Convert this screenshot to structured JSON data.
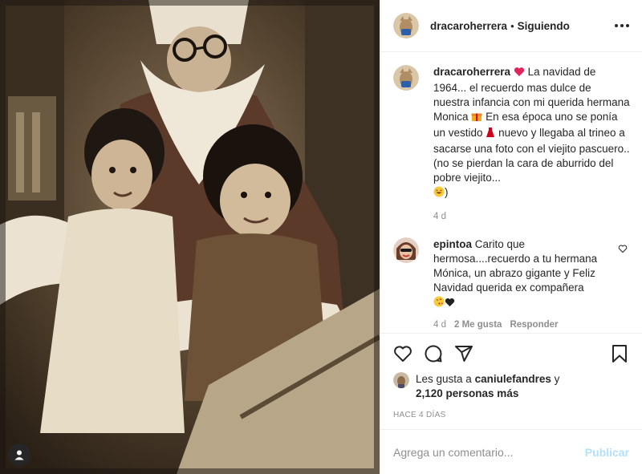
{
  "post": {
    "author": "dracaroherrera",
    "follow_separator": "•",
    "follow_state": "Siguiendo",
    "caption_lines": [
      "La navidad de",
      "1964... el recuerdo mas dulce de",
      "nuestra infancia con mi querida",
      "hermana Monica",
      "En esa época uno",
      "se ponía un vestido",
      "nuevo y",
      "llegaba al trineo a sacarse una foto",
      "con el viejito pascuero.. (no se pierdan",
      "la cara de aburrido del pobre viejito...",
      ")"
    ],
    "caption_age": "4 d"
  },
  "comment": {
    "author": "epintoa",
    "lines": [
      "Carito que",
      "hermosa....recuerdo a tu hermana",
      "Mónica, un abrazo gigante y Feliz",
      "Navidad querida ex compañera"
    ],
    "age": "4 d",
    "likes": "2 Me gusta",
    "reply": "Responder"
  },
  "likes": {
    "prefix": "Les gusta a",
    "user": "caniulefandres",
    "joiner": "y",
    "count": "2,120 personas más"
  },
  "date": "HACE 4 DÍAS",
  "add_comment": {
    "placeholder": "Agrega un comentario...",
    "publish": "Publicar"
  },
  "icons": {
    "more": "more-options-icon",
    "heart": "heart-icon",
    "comment": "comment-icon",
    "share": "share-icon",
    "save": "bookmark-icon",
    "user_tag": "user-tag-icon"
  },
  "colors": {
    "text": "#262626",
    "muted": "#8e8e8e",
    "border": "#efefef",
    "publish_disabled": "#b2dffc"
  }
}
